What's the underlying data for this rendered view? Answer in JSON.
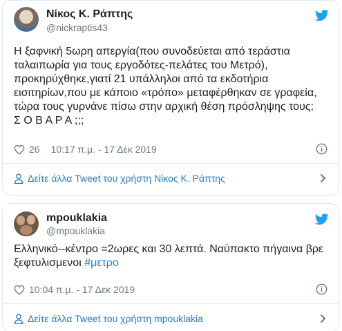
{
  "colors": {
    "text": "#1c2022",
    "muted": "#697882",
    "link": "#2b7bb9",
    "twitter_blue": "#1da1f2",
    "border": "#e1e8ed"
  },
  "tweets": [
    {
      "author_name": "Νίκος Κ. Ράπτης",
      "author_handle": "@nickraptis43",
      "lines": [
        "Η ξαφνική 5ωρη απεργία(που συνοδεύεται από τεράστια",
        "ταλαιπωρία για τους εργοδότες-πελάτες του Μετρό),",
        "προκηρύχθηκε,γιατί 21 υπάλληλοι από τα εκδοτήρια",
        "εισιτηρίων,που με κάποιο «τρόπο» μεταφέρθηκαν σε γραφεία,",
        "τώρα τους γυρνάνε πίσω στην αρχική θέση πρόσληψης τους;",
        "Σ Ο Β Α Ρ Α ;;;"
      ],
      "likes": "26",
      "timestamp": "10:17 π.μ. - 17 Δεκ 2019",
      "more_link": "Δείτε άλλα Tweet του χρήστη Νίκος Κ. Ράπτης"
    },
    {
      "author_name": "mpouklakia",
      "author_handle": "@mpouklakia",
      "line1": "Ελληνικό--κέντρο =2ωρες και 30 λεπτά. Ναύπακτο πήγαινα βρε",
      "line2_text": "ξεφτυλισμενοι ",
      "hashtag": "#μετρο",
      "timestamp": "10:04 π.μ. - 17 Δεκ 2019",
      "more_link": "Δείτε άλλα Tweet του χρήστη mpouklakia"
    }
  ],
  "icons": {
    "bird": "twitter-bird-icon",
    "heart": "heart-icon",
    "info": "info-icon",
    "person": "person-icon",
    "chevron": "chevron-right-icon"
  }
}
